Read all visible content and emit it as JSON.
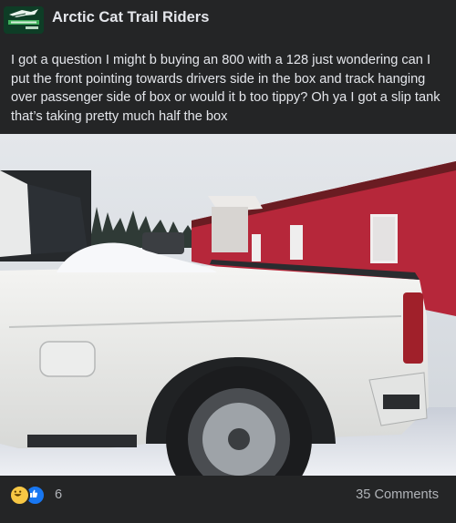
{
  "group": {
    "name": "Arctic Cat Trail Riders",
    "logo_text": "ARCTIC CAT",
    "logo_subtext": "Trail Riders"
  },
  "post": {
    "text": "I got a question I might b buying an 800 with a 128 just wondering can I put the front pointing towards drivers side in the box and track hanging over passenger side of box or would it b too tippy? Oh ya I got a slip tank that’s taking pretty much half the box"
  },
  "reactions": {
    "icons": [
      "haha-icon",
      "like-icon"
    ],
    "count": "6"
  },
  "comments": {
    "label": "35 Comments"
  },
  "colors": {
    "background": "#242526",
    "text_primary": "#e4e6eb",
    "text_secondary": "#b0b3b8",
    "like_blue": "#1877f2",
    "haha_yellow": "#f7c744"
  }
}
